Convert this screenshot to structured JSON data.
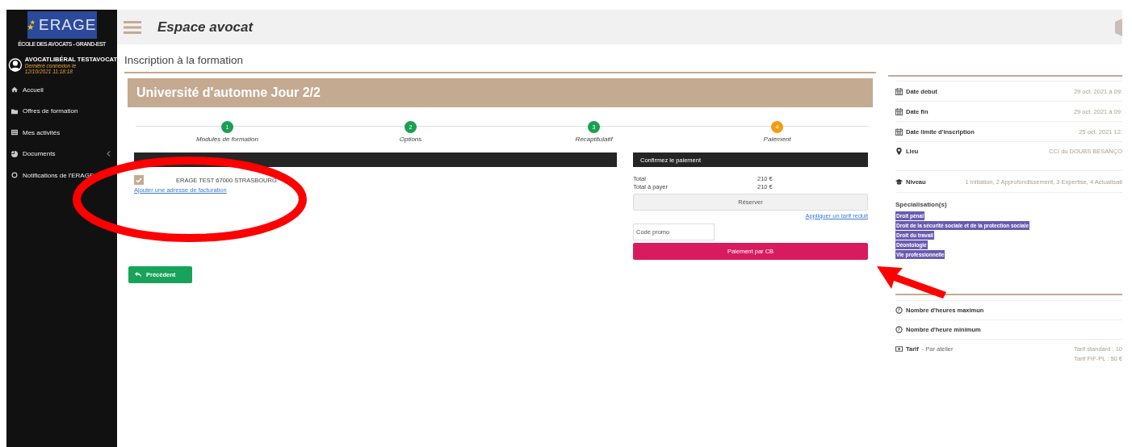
{
  "sidebar": {
    "logo": {
      "text": "ERAGE",
      "subtitle": "ÉCOLE DES AVOCATS - GRAND-EST"
    },
    "user": {
      "name": "AVOCATLIBÉRAL TESTAVOCAT",
      "last_login_label": "Dernière connexion le",
      "last_login": "12/10/2021 11:18:18"
    },
    "items": [
      {
        "label": "Accueil",
        "kind": "home",
        "expandable": false
      },
      {
        "label": "Offres de formation",
        "kind": "folder",
        "expandable": false
      },
      {
        "label": "Mes activités",
        "kind": "list",
        "expandable": false
      },
      {
        "label": "Documents",
        "kind": "chart",
        "expandable": true
      },
      {
        "label": "Notifications de l'ERAGE",
        "kind": "bell",
        "expandable": false
      }
    ]
  },
  "header": {
    "title": "Espace avocat"
  },
  "page_title": "Inscription à la formation",
  "training": {
    "title": "Université d'automne Jour 2/2"
  },
  "steps": [
    {
      "number": "1",
      "label": "Modules de formation",
      "completed": true
    },
    {
      "number": "2",
      "label": "Options",
      "completed": true
    },
    {
      "number": "3",
      "label": "Recaptitulatif",
      "completed": true
    },
    {
      "number": "4",
      "label": "Paiement",
      "completed": false
    }
  ],
  "billing": {
    "addresses": [
      {
        "text": "ERAGE TEST 67000 STRASBOURG",
        "checked": true
      }
    ],
    "add_link": "Ajouter une adresse de facturation"
  },
  "payment": {
    "header": "Confirmez le paiement",
    "lines": [
      {
        "label": "Total",
        "amount": "210 €"
      },
      {
        "label": "Total à payer",
        "amount": "210 €"
      }
    ],
    "reserve_button": "Réserver",
    "discount_link": "Appliquer un tarif reduit",
    "promo": {
      "placeholder": "Code promo"
    },
    "pay_button": "Paiement par CB"
  },
  "back_button": "Précédent",
  "details": {
    "rows": [
      {
        "kind": "date",
        "label": "Date debut",
        "value": "29 oct. 2021 à 09:"
      },
      {
        "kind": "date",
        "label": "Date fin",
        "value": "29 oct. 2021 à 09:"
      },
      {
        "kind": "date",
        "label": "Date limite d'inscription",
        "value": "25 oct. 2021 12:"
      },
      {
        "kind": "place",
        "label": "Lieu",
        "value": "CCI du DOUBS BESANÇO"
      },
      {
        "kind": "level",
        "label": "Niveau",
        "value": "1 Initiation, 2 Approfondissement, 3 Expertise, 4 Actualisati"
      }
    ],
    "specialisation_title": "Spécialisation(s)",
    "specialisations": [
      "Droit pénal",
      "Droit de la sécurité sociale et de la protection sociale",
      "Droit du travail",
      "Déontologie",
      "Vie professionnelle"
    ],
    "more_rows": [
      {
        "kind": "hours",
        "label": "Nombre d'heures maximun"
      },
      {
        "kind": "hours",
        "label": "Nombre d'heure minimum"
      },
      {
        "kind": "price",
        "label": "Tarif",
        "note": "- Par atelier",
        "values": [
          "Tarif standard : 10",
          "Tarif FIF-PL : 50 €"
        ]
      }
    ]
  }
}
